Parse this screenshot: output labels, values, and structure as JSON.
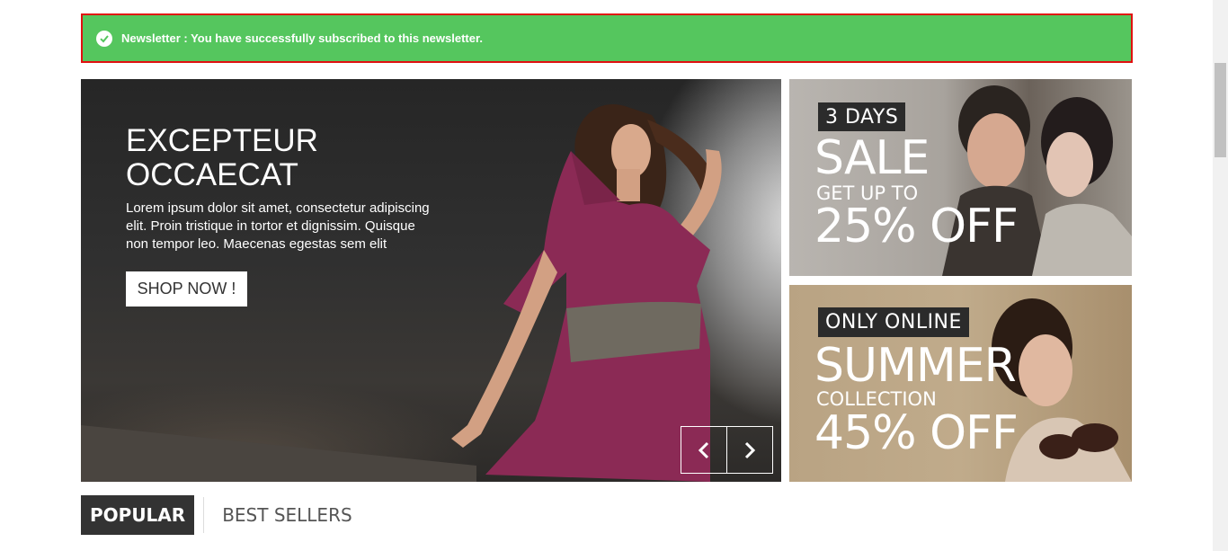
{
  "alert": {
    "message": "Newsletter : You have successfully subscribed to this newsletter.",
    "icon": "check-circle-icon",
    "color": "#55c65e"
  },
  "slider": {
    "title": "EXCEPTEUR OCCAECAT",
    "description": "Lorem ipsum dolor sit amet, consectetur adipiscing elit. Proin tristique in tortor et dignissim. Quisque non tempor leo. Maecenas egestas sem elit",
    "button_label": "SHOP NOW !",
    "prev_icon": "chevron-left-icon",
    "next_icon": "chevron-right-icon"
  },
  "banners": [
    {
      "tag": "3 DAYS",
      "headline": "SALE",
      "sub": "GET UP TO",
      "offer": "25% OFF"
    },
    {
      "tag": "ONLY ONLINE",
      "headline": "SUMMER",
      "sub": "COLLECTION",
      "offer": "45% OFF"
    }
  ],
  "tabs": [
    {
      "label": "POPULAR",
      "active": true
    },
    {
      "label": "BEST SELLERS",
      "active": false
    }
  ]
}
